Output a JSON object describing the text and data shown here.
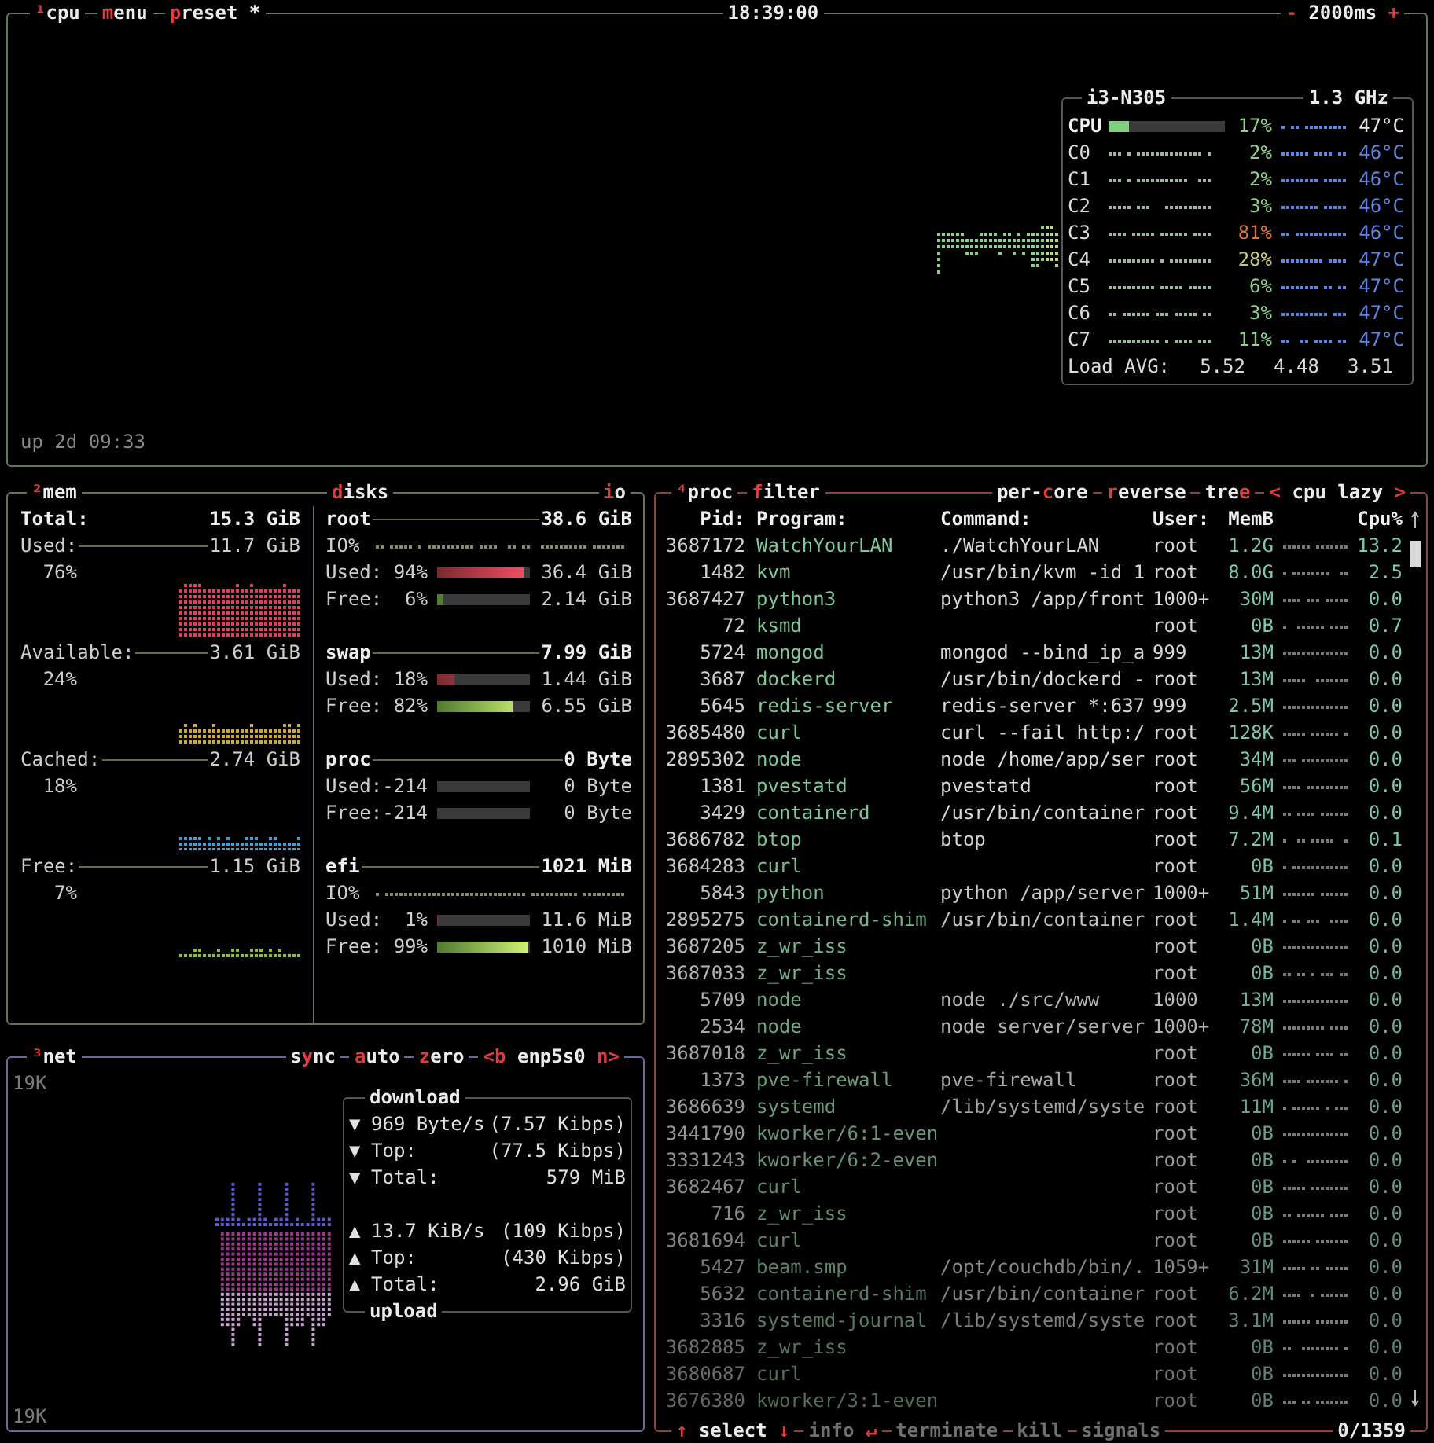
{
  "cpu": {
    "tabs": [
      {
        "segments": [
          {
            "text": "¹",
            "hot": true
          },
          {
            "text": "cpu",
            "hot": false
          }
        ]
      },
      {
        "segments": [
          {
            "text": "m",
            "hot": true
          },
          {
            "text": "enu",
            "hot": false
          }
        ]
      },
      {
        "segments": [
          {
            "text": "p",
            "hot": true
          },
          {
            "text": "reset *",
            "hot": false
          }
        ]
      }
    ],
    "clock": "18:39:00",
    "interval": {
      "segments": [
        {
          "text": "-",
          "hot": true
        },
        {
          "text": " 2000ms ",
          "hot": false
        },
        {
          "text": "+",
          "hot": true
        }
      ]
    },
    "uptime": "up 2d 09:33",
    "model": "i3-N305",
    "freq": "1.3 GHz",
    "cores": [
      {
        "kind": "total",
        "name": "CPU",
        "level": 0.17,
        "percent": "17%",
        "color": "#8fd08f",
        "temp": "47°C"
      },
      {
        "kind": "core",
        "name": "C0",
        "percent": "2%",
        "color": "#8fd08f",
        "temp": "46°C"
      },
      {
        "kind": "core",
        "name": "C1",
        "percent": "2%",
        "color": "#8fd08f",
        "temp": "46°C"
      },
      {
        "kind": "core",
        "name": "C2",
        "percent": "3%",
        "color": "#8fd08f",
        "temp": "46°C"
      },
      {
        "kind": "core",
        "name": "C3",
        "percent": "81%",
        "color": "#e07040",
        "temp": "46°C"
      },
      {
        "kind": "core",
        "name": "C4",
        "percent": "28%",
        "color": "#c8c878",
        "temp": "47°C"
      },
      {
        "kind": "core",
        "name": "C5",
        "percent": "6%",
        "color": "#8fd08f",
        "temp": "47°C"
      },
      {
        "kind": "core",
        "name": "C6",
        "percent": "3%",
        "color": "#8fd08f",
        "temp": "47°C"
      },
      {
        "kind": "core",
        "name": "C7",
        "percent": "11%",
        "color": "#8fd08f",
        "temp": "47°C"
      }
    ],
    "load": {
      "label": "Load AVG:",
      "values": [
        "5.52",
        "4.48",
        "3.51"
      ]
    }
  },
  "mem": {
    "tab": {
      "segments": [
        {
          "text": "²",
          "hot": true
        },
        {
          "text": "mem",
          "hot": false
        }
      ]
    },
    "disks_tab": {
      "segments": [
        {
          "text": "d",
          "hot": true
        },
        {
          "text": "isks",
          "hot": false
        }
      ]
    },
    "io_tab": {
      "segments": [
        {
          "text": "i",
          "hot": true
        },
        {
          "text": "o",
          "hot": false
        }
      ]
    },
    "total": {
      "label": "Total:",
      "value": "15.3 GiB"
    },
    "items": [
      {
        "label": "Used:",
        "value": "11.7 GiB",
        "percent": "76%",
        "color": "#e0405a"
      },
      {
        "label": "Available:",
        "value": "3.61 GiB",
        "percent": "24%",
        "color": "#c8a838"
      },
      {
        "label": "Cached:",
        "value": "2.74 GiB",
        "percent": "18%",
        "color": "#3fa0d8"
      },
      {
        "label": "Free:",
        "value": "1.15 GiB",
        "percent": "7%",
        "color": "#8fbf40"
      }
    ],
    "disks": [
      {
        "name": "root",
        "size": "38.6 GiB",
        "rows": [
          {
            "kind": "io",
            "label": "IO%"
          },
          {
            "kind": "used",
            "label": "Used:",
            "percent": "94%",
            "level": 0.94,
            "value": "36.4 GiB"
          },
          {
            "kind": "free",
            "label": "Free:",
            "percent": "6%",
            "level": 0.06,
            "value": "2.14 GiB"
          }
        ]
      },
      {
        "name": "swap",
        "size": "7.99 GiB",
        "rows": [
          {
            "kind": "used",
            "label": "Used:",
            "percent": "18%",
            "level": 0.18,
            "value": "1.44 GiB"
          },
          {
            "kind": "free",
            "label": "Free:",
            "percent": "82%",
            "level": 0.82,
            "value": "6.55 GiB"
          }
        ]
      },
      {
        "name": "proc",
        "size": "0 Byte",
        "rows": [
          {
            "kind": "used",
            "label": "Used:",
            "percent": "-214",
            "level": 0,
            "value": "0 Byte"
          },
          {
            "kind": "free",
            "label": "Free:",
            "percent": "-214",
            "level": 0,
            "value": "0 Byte"
          }
        ]
      },
      {
        "name": "efi",
        "size": "1021 MiB",
        "rows": [
          {
            "kind": "io",
            "label": "IO%"
          },
          {
            "kind": "used",
            "label": "Used:",
            "percent": "1%",
            "level": 0.01,
            "value": "11.6 MiB"
          },
          {
            "kind": "free",
            "label": "Free:",
            "percent": "99%",
            "level": 0.99,
            "value": "1010 MiB"
          }
        ]
      }
    ]
  },
  "net": {
    "tab": {
      "segments": [
        {
          "text": "³",
          "hot": true
        },
        {
          "text": "net",
          "hot": false
        }
      ]
    },
    "options": [
      {
        "segments": [
          {
            "text": "s",
            "hot": false
          },
          {
            "text": "y",
            "hot": true
          },
          {
            "text": "nc",
            "hot": false
          }
        ]
      },
      {
        "segments": [
          {
            "text": "a",
            "hot": true
          },
          {
            "text": "uto",
            "hot": false
          }
        ]
      },
      {
        "segments": [
          {
            "text": "z",
            "hot": true
          },
          {
            "text": "ero",
            "hot": false
          }
        ]
      },
      {
        "segments": [
          {
            "text": "<b",
            "hot": true
          },
          {
            "text": " enp5s0 ",
            "hot": false
          },
          {
            "text": "n>",
            "hot": true
          }
        ]
      }
    ],
    "scale_top": "19K",
    "scale_bottom": "19K",
    "download": {
      "title": "download",
      "rows": [
        {
          "arrow": "▼",
          "label": "969 Byte/s",
          "value": "(7.57 Kibps)"
        },
        {
          "arrow": "▼",
          "label": "Top:",
          "value": "(77.5 Kibps)"
        },
        {
          "arrow": "▼",
          "label": "Total:",
          "value": "579 MiB"
        }
      ]
    },
    "upload": {
      "title": "upload",
      "rows": [
        {
          "arrow": "▲",
          "label": "13.7 KiB/s",
          "value": "(109 Kibps)"
        },
        {
          "arrow": "▲",
          "label": "Top:",
          "value": "(430 Kibps)"
        },
        {
          "arrow": "▲",
          "label": "Total:",
          "value": "2.96 GiB"
        }
      ]
    }
  },
  "proc": {
    "tabs": [
      {
        "segments": [
          {
            "text": "⁴",
            "hot": true
          },
          {
            "text": "proc",
            "hot": false
          }
        ]
      },
      {
        "segments": [
          {
            "text": "f",
            "hot": true
          },
          {
            "text": "ilter",
            "hot": false
          }
        ]
      }
    ],
    "options": [
      {
        "segments": [
          {
            "text": "per-",
            "hot": false
          },
          {
            "text": "c",
            "hot": true
          },
          {
            "text": "ore",
            "hot": false
          }
        ]
      },
      {
        "segments": [
          {
            "text": "r",
            "hot": true
          },
          {
            "text": "everse",
            "hot": false
          }
        ]
      },
      {
        "segments": [
          {
            "text": "tre",
            "hot": false
          },
          {
            "text": "e",
            "hot": true
          }
        ]
      },
      {
        "segments": [
          {
            "text": "<",
            "hot": true
          },
          {
            "text": " cpu lazy ",
            "hot": false
          },
          {
            "text": ">",
            "hot": true
          }
        ]
      }
    ],
    "columns": [
      "Pid:",
      "Program:",
      "Command:",
      "User:",
      "MemB",
      "Cpu%"
    ],
    "rows": [
      {
        "pid": "3687172",
        "program": "WatchYourLAN",
        "command": "./WatchYourLAN",
        "user": "root",
        "mem": "1.2G",
        "cpu": "13.2"
      },
      {
        "pid": "1482",
        "program": "kvm",
        "command": "/usr/bin/kvm -id 1",
        "user": "root",
        "mem": "8.0G",
        "cpu": "2.5"
      },
      {
        "pid": "3687427",
        "program": "python3",
        "command": "python3 /app/front",
        "user": "1000+",
        "mem": "30M",
        "cpu": "0.0"
      },
      {
        "pid": "72",
        "program": "ksmd",
        "user": "root",
        "mem": "0B",
        "cpu": "0.7"
      },
      {
        "pid": "5724",
        "program": "mongod",
        "command": "mongod --bind_ip_a",
        "user": "999",
        "mem": "13M",
        "cpu": "0.0"
      },
      {
        "pid": "3687",
        "program": "dockerd",
        "command": "/usr/bin/dockerd -",
        "user": "root",
        "mem": "13M",
        "cpu": "0.0"
      },
      {
        "pid": "5645",
        "program": "redis-server",
        "command": "redis-server *:637",
        "user": "999",
        "mem": "2.5M",
        "cpu": "0.0"
      },
      {
        "pid": "3685480",
        "program": "curl",
        "command": "curl --fail http:/",
        "user": "root",
        "mem": "128K",
        "cpu": "0.0"
      },
      {
        "pid": "2895302",
        "program": "node",
        "command": "node /home/app/ser",
        "user": "root",
        "mem": "34M",
        "cpu": "0.0"
      },
      {
        "pid": "1381",
        "program": "pvestatd",
        "command": "pvestatd",
        "user": "root",
        "mem": "56M",
        "cpu": "0.0"
      },
      {
        "pid": "3429",
        "program": "containerd",
        "command": "/usr/bin/container",
        "user": "root",
        "mem": "9.4M",
        "cpu": "0.0"
      },
      {
        "pid": "3686782",
        "program": "btop",
        "command": "btop",
        "user": "root",
        "mem": "7.2M",
        "cpu": "0.1"
      },
      {
        "pid": "3684283",
        "program": "curl",
        "user": "root",
        "mem": "0B",
        "cpu": "0.0"
      },
      {
        "pid": "5843",
        "program": "python",
        "command": "python /app/server",
        "user": "1000+",
        "mem": "51M",
        "cpu": "0.0"
      },
      {
        "pid": "2895275",
        "program": "containerd-shim",
        "command": "/usr/bin/container",
        "user": "root",
        "mem": "1.4M",
        "cpu": "0.0"
      },
      {
        "pid": "3687205",
        "program": "z_wr_iss",
        "user": "root",
        "mem": "0B",
        "cpu": "0.0"
      },
      {
        "pid": "3687033",
        "program": "z_wr_iss",
        "user": "root",
        "mem": "0B",
        "cpu": "0.0"
      },
      {
        "pid": "5709",
        "program": "node",
        "command": "node ./src/www",
        "user": "1000",
        "mem": "13M",
        "cpu": "0.0"
      },
      {
        "pid": "2534",
        "program": "node",
        "command": "node server/server",
        "user": "1000+",
        "mem": "78M",
        "cpu": "0.0"
      },
      {
        "pid": "3687018",
        "program": "z_wr_iss",
        "user": "root",
        "mem": "0B",
        "cpu": "0.0"
      },
      {
        "pid": "1373",
        "program": "pve-firewall",
        "command": "pve-firewall",
        "user": "root",
        "mem": "36M",
        "cpu": "0.0"
      },
      {
        "pid": "3686639",
        "program": "systemd",
        "command": "/lib/systemd/syste",
        "user": "root",
        "mem": "11M",
        "cpu": "0.0"
      },
      {
        "pid": "3441790",
        "program": "kworker/6:1-even",
        "user": "root",
        "mem": "0B",
        "cpu": "0.0"
      },
      {
        "pid": "3331243",
        "program": "kworker/6:2-even",
        "user": "root",
        "mem": "0B",
        "cpu": "0.0"
      },
      {
        "pid": "3682467",
        "program": "curl",
        "user": "root",
        "mem": "0B",
        "cpu": "0.0"
      },
      {
        "pid": "716",
        "program": "z_wr_iss",
        "user": "root",
        "mem": "0B",
        "cpu": "0.0"
      },
      {
        "pid": "3681694",
        "program": "curl",
        "user": "root",
        "mem": "0B",
        "cpu": "0.0"
      },
      {
        "pid": "5427",
        "program": "beam.smp",
        "command": "/opt/couchdb/bin/.",
        "user": "1059+",
        "mem": "31M",
        "cpu": "0.0"
      },
      {
        "pid": "5632",
        "program": "containerd-shim",
        "command": "/usr/bin/container",
        "user": "root",
        "mem": "6.2M",
        "cpu": "0.0"
      },
      {
        "pid": "3316",
        "program": "systemd-journal",
        "command": "/lib/systemd/syste",
        "user": "root",
        "mem": "3.1M",
        "cpu": "0.0"
      },
      {
        "pid": "3682885",
        "program": "z_wr_iss",
        "user": "root",
        "mem": "0B",
        "cpu": "0.0"
      },
      {
        "pid": "3680687",
        "program": "curl",
        "user": "root",
        "mem": "0B",
        "cpu": "0.0"
      },
      {
        "pid": "3676380",
        "program": "kworker/3:1-even",
        "user": "root",
        "mem": "0B",
        "cpu": "0.0"
      }
    ],
    "footer": [
      {
        "disabled": false,
        "segments": [
          {
            "text": "↑",
            "hot": true
          },
          {
            "text": " select ",
            "hot": false
          },
          {
            "text": "↓",
            "hot": true
          }
        ]
      },
      {
        "disabled": true,
        "segments": [
          {
            "text": "info ",
            "hot": false
          },
          {
            "text": "↵",
            "hot": true
          }
        ]
      },
      {
        "disabled": true,
        "segments": [
          {
            "text": "terminate",
            "hot": false
          }
        ]
      },
      {
        "disabled": true,
        "segments": [
          {
            "text": "kill",
            "hot": false
          }
        ]
      },
      {
        "disabled": true,
        "segments": [
          {
            "text": "signals",
            "hot": false
          }
        ]
      }
    ],
    "count": "0/1359"
  }
}
